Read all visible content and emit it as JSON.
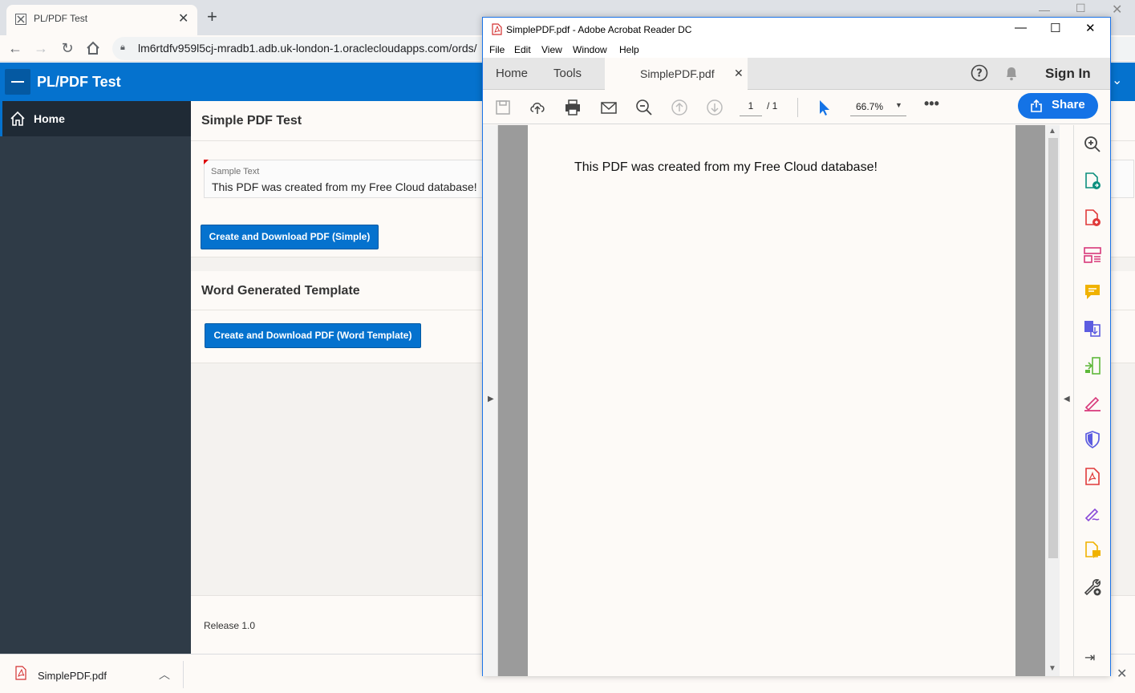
{
  "browser": {
    "tab_title": "PL/PDF Test",
    "url": "lm6rtdfv959l5cj-mradb1.adb.uk-london-1.oraclecloudapps.com/ords/"
  },
  "app": {
    "title": "PL/PDF Test",
    "nav": [
      {
        "label": "Home",
        "icon": "home-icon"
      }
    ],
    "regions": [
      {
        "title": "Simple PDF Test",
        "field_label": "Sample Text",
        "field_value": "This PDF was created from my Free Cloud database!",
        "button": "Create and Download PDF (Simple)"
      },
      {
        "title": "Word Generated Template",
        "button": "Create and Download PDF (Word Template)"
      }
    ],
    "footer": "Release 1.0",
    "accent": "#0572ce"
  },
  "downloads": {
    "file": "SimplePDF.pdf"
  },
  "acrobat": {
    "window_title": "SimplePDF.pdf - Adobe Acrobat Reader DC",
    "menu": [
      "File",
      "Edit",
      "View",
      "Window",
      "Help"
    ],
    "tabs": {
      "home": "Home",
      "tools": "Tools",
      "doc": "SimplePDF.pdf"
    },
    "sign_in": "Sign In",
    "page_current": "1",
    "page_total": "/ 1",
    "zoom": "66.7%",
    "share": "Share",
    "pdf_text": "This PDF was created from my Free Cloud database!",
    "share_color": "#1473e6"
  }
}
